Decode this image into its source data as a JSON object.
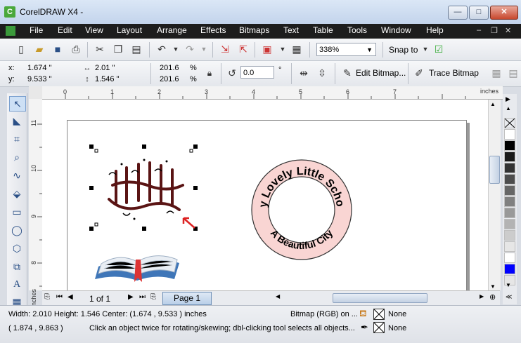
{
  "window": {
    "title": "CorelDRAW X4 -",
    "icon": "C"
  },
  "menu": [
    "File",
    "Edit",
    "View",
    "Layout",
    "Arrange",
    "Effects",
    "Bitmaps",
    "Text",
    "Table",
    "Tools",
    "Window",
    "Help"
  ],
  "toolbar": {
    "zoom": "338%",
    "snap_to": "Snap to"
  },
  "propbar": {
    "x_label": "x:",
    "x_value": "1.674 \"",
    "y_label": "y:",
    "y_value": "9.533 \"",
    "w_value": "2.01 \"",
    "h_value": "1.546 \"",
    "scale_w": "201.6",
    "scale_h": "201.6",
    "pct": "%",
    "rotation": "0.0",
    "degree": "°",
    "edit_bitmap": "Edit Bitmap...",
    "trace_bitmap": "Trace Bitmap"
  },
  "ruler": {
    "units": "inches",
    "h_ticks": [
      "0",
      "1",
      "2",
      "3",
      "4",
      "5",
      "6",
      "7"
    ],
    "v_ticks": [
      "11",
      "10",
      "9",
      "8"
    ],
    "v_units": "inches"
  },
  "canvas": {
    "ring_text_top": "My Lovely Little School",
    "ring_text_bottom": "A Beautiful City",
    "ring_color": "#f9d5d3"
  },
  "pagenav": {
    "counter": "1 of 1",
    "tab": "Page 1"
  },
  "palette": [
    "#ffffff",
    "#000000",
    "#1a1a1a",
    "#333333",
    "#4d4d4d",
    "#666666",
    "#808080",
    "#999999",
    "#b3b3b3",
    "#cccccc",
    "#e6e6e6",
    "#ffffff",
    "#0000ff",
    "#e6e6e6"
  ],
  "status": {
    "size_info": "Width: 2.010  Height: 1.546  Center: (1.674 , 9.533 )  inches",
    "object_type": "Bitmap (RGB) on ...",
    "fill": "None",
    "outline": "None",
    "cursor": "( 1.874 , 9.863 )",
    "hint": "Click an object twice for rotating/skewing; dbl-clicking tool selects all objects..."
  }
}
